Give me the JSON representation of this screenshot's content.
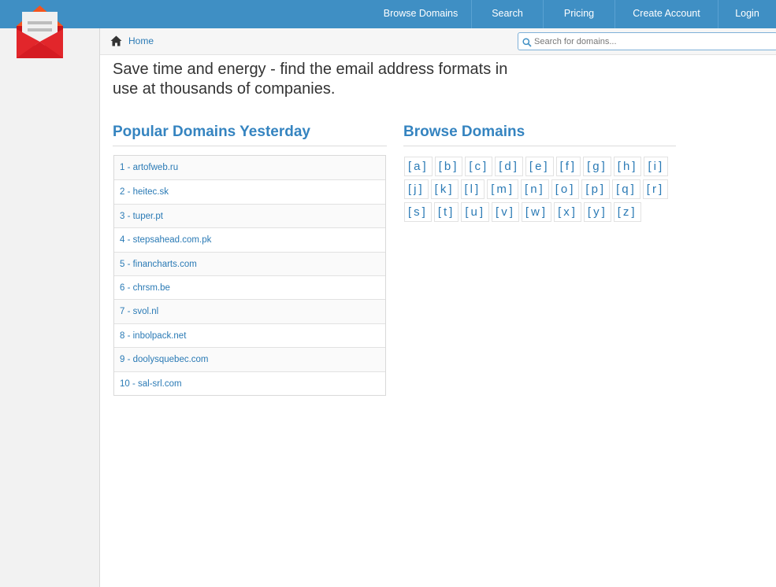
{
  "nav": {
    "items": [
      {
        "label": "Browse Domains"
      },
      {
        "label": "Search"
      },
      {
        "label": "Pricing"
      },
      {
        "label": "Create Account"
      },
      {
        "label": "Login"
      }
    ]
  },
  "breadcrumb": {
    "home_label": "Home"
  },
  "search": {
    "placeholder": "Search for domains..."
  },
  "tagline": "Save time and energy - find the email address formats in use at thousands of companies.",
  "popular": {
    "heading": "Popular Domains Yesterday",
    "items": [
      "1 - artofweb.ru",
      "2 - heitec.sk",
      "3 - tuper.pt",
      "4 - stepsahead.com.pk",
      "5 - financharts.com",
      "6 - chrsm.be",
      "7 - svol.nl",
      "8 - inbolpack.net",
      "9 - doolysquebec.com",
      "10 - sal-srl.com"
    ]
  },
  "browse": {
    "heading": "Browse Domains",
    "rows": [
      [
        "[a]",
        "[b]",
        "[c]",
        "[d]",
        "[e]",
        "[f]",
        "[g]",
        "[h]",
        "[i]"
      ],
      [
        "[j]",
        "[k]",
        "[l]",
        "[m]",
        "[n]",
        "[o]",
        "[p]",
        "[q]",
        "[r]"
      ],
      [
        "[s]",
        "[t]",
        "[u]",
        "[v]",
        "[w]",
        "[x]",
        "[y]",
        "[z]"
      ]
    ]
  },
  "colors": {
    "brand_blue": "#3f8fc4",
    "link_blue": "#2a7ab5",
    "logo_red": "#e2262b",
    "logo_orange": "#f4541d"
  },
  "icons": {
    "logo": "email-envelope-logo-icon",
    "home": "home-icon",
    "search": "search-icon"
  }
}
